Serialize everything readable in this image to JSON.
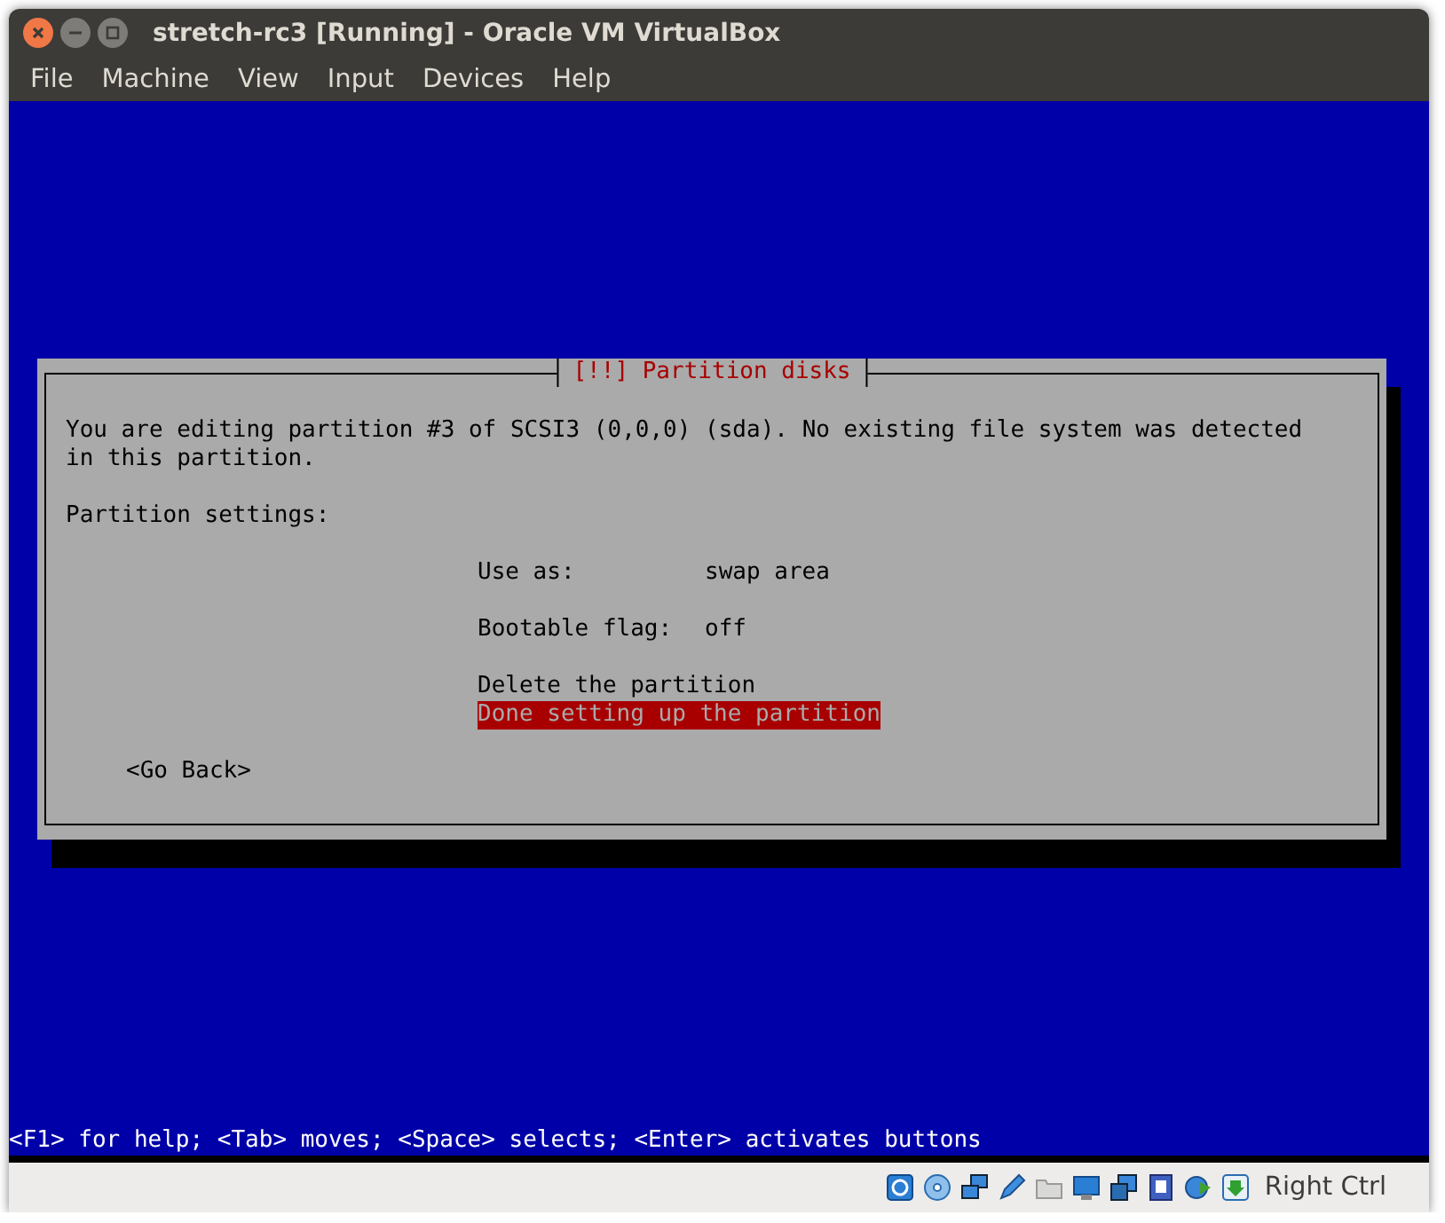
{
  "window": {
    "title": "stretch-rc3 [Running] - Oracle VM VirtualBox"
  },
  "menu": [
    "File",
    "Machine",
    "View",
    "Input",
    "Devices",
    "Help"
  ],
  "dialog": {
    "title": "[!!] Partition disks",
    "message": "You are editing partition #3 of SCSI3 (0,0,0) (sda). No existing file system was detected in this partition.",
    "section": "Partition settings:",
    "settings": [
      {
        "label": "Use as:",
        "value": "swap area"
      },
      {
        "label": "Bootable flag:",
        "value": "off"
      }
    ],
    "actions": [
      {
        "label": "Delete the partition",
        "selected": false
      },
      {
        "label": "Done setting up the partition",
        "selected": true
      }
    ],
    "back_button": "<Go Back>"
  },
  "help_line": "<F1> for help; <Tab> moves; <Space> selects; <Enter> activates buttons",
  "status_bar": {
    "host_key": "Right Ctrl"
  }
}
